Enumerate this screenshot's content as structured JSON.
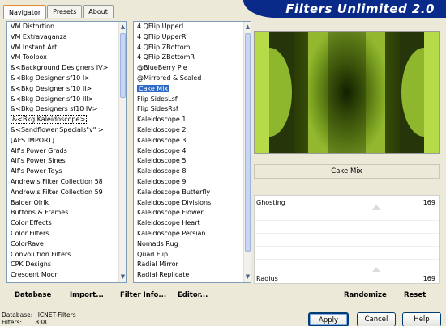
{
  "tabs": [
    "Navigator",
    "Presets",
    "About"
  ],
  "app_title": "Filters Unlimited 2.0",
  "categories": [
    "VM Distortion",
    "VM Extravaganza",
    "VM Instant Art",
    "VM Toolbox",
    "&<Background Designers IV>",
    "&<Bkg Designer sf10 I>",
    "&<Bkg Designer sf10 II>",
    "&<Bkg Designer sf10 III>",
    "&<Bkg Designers sf10 IV>",
    "&<Bkg Kaleidoscope>",
    "&<Sandflower Specials\"v\" >",
    "[AFS IMPORT]",
    "Alf's Power Grads",
    "Alf's Power Sines",
    "Alf's Power Toys",
    "Andrew's Filter Collection 58",
    "Andrew's Filter Collection 59",
    "Balder Olrik",
    "Buttons & Frames",
    "Color Effects",
    "Color Filters",
    "ColorRave",
    "Convolution Filters",
    "CPK Designs",
    "Crescent Moon"
  ],
  "filters": [
    "4 QFlip UpperL",
    "4 QFlip UpperR",
    "4 QFlip ZBottomL",
    "4 QFlip ZBottomR",
    "@BlueBerry Pie",
    "@Mirrored & Scaled",
    "Cake Mix",
    "Flip SidesLsf",
    "Flip SidesRsf",
    "Kaleidoscope 1",
    "Kaleidoscope 2",
    "Kaleidoscope 3",
    "Kaleidoscope 4",
    "Kaleidoscope 5",
    "Kaleidoscope 8",
    "Kaleidoscope 9",
    "Kaleidoscope Butterfly",
    "Kaleidoscope Divisions",
    "Kaleidoscope Flower",
    "Kaleidoscope Heart",
    "Kaleidoscope Persian",
    "Nomads Rug",
    "Quad Flip",
    "Radial Mirror",
    "Radial Replicate"
  ],
  "left_buttons": [
    "Database",
    "Import...",
    "Filter Info...",
    "Editor..."
  ],
  "filter_name": "Cake Mix",
  "params": [
    {
      "label": "Ghosting",
      "value": "169",
      "position": 0.66
    },
    {
      "label": "Radius",
      "value": "169",
      "position": 0.66
    }
  ],
  "right_buttons": [
    "Randomize",
    "Reset"
  ],
  "status": {
    "database_label": "Database:",
    "database_value": "ICNET-Filters",
    "filters_label": "Filters:",
    "filters_value": "838"
  },
  "dialog_buttons": [
    "Apply",
    "Cancel",
    "Help"
  ],
  "colors": {
    "selection": "#316ac5",
    "banner": "#0a2a8a",
    "preview_green": "#b5db49"
  }
}
